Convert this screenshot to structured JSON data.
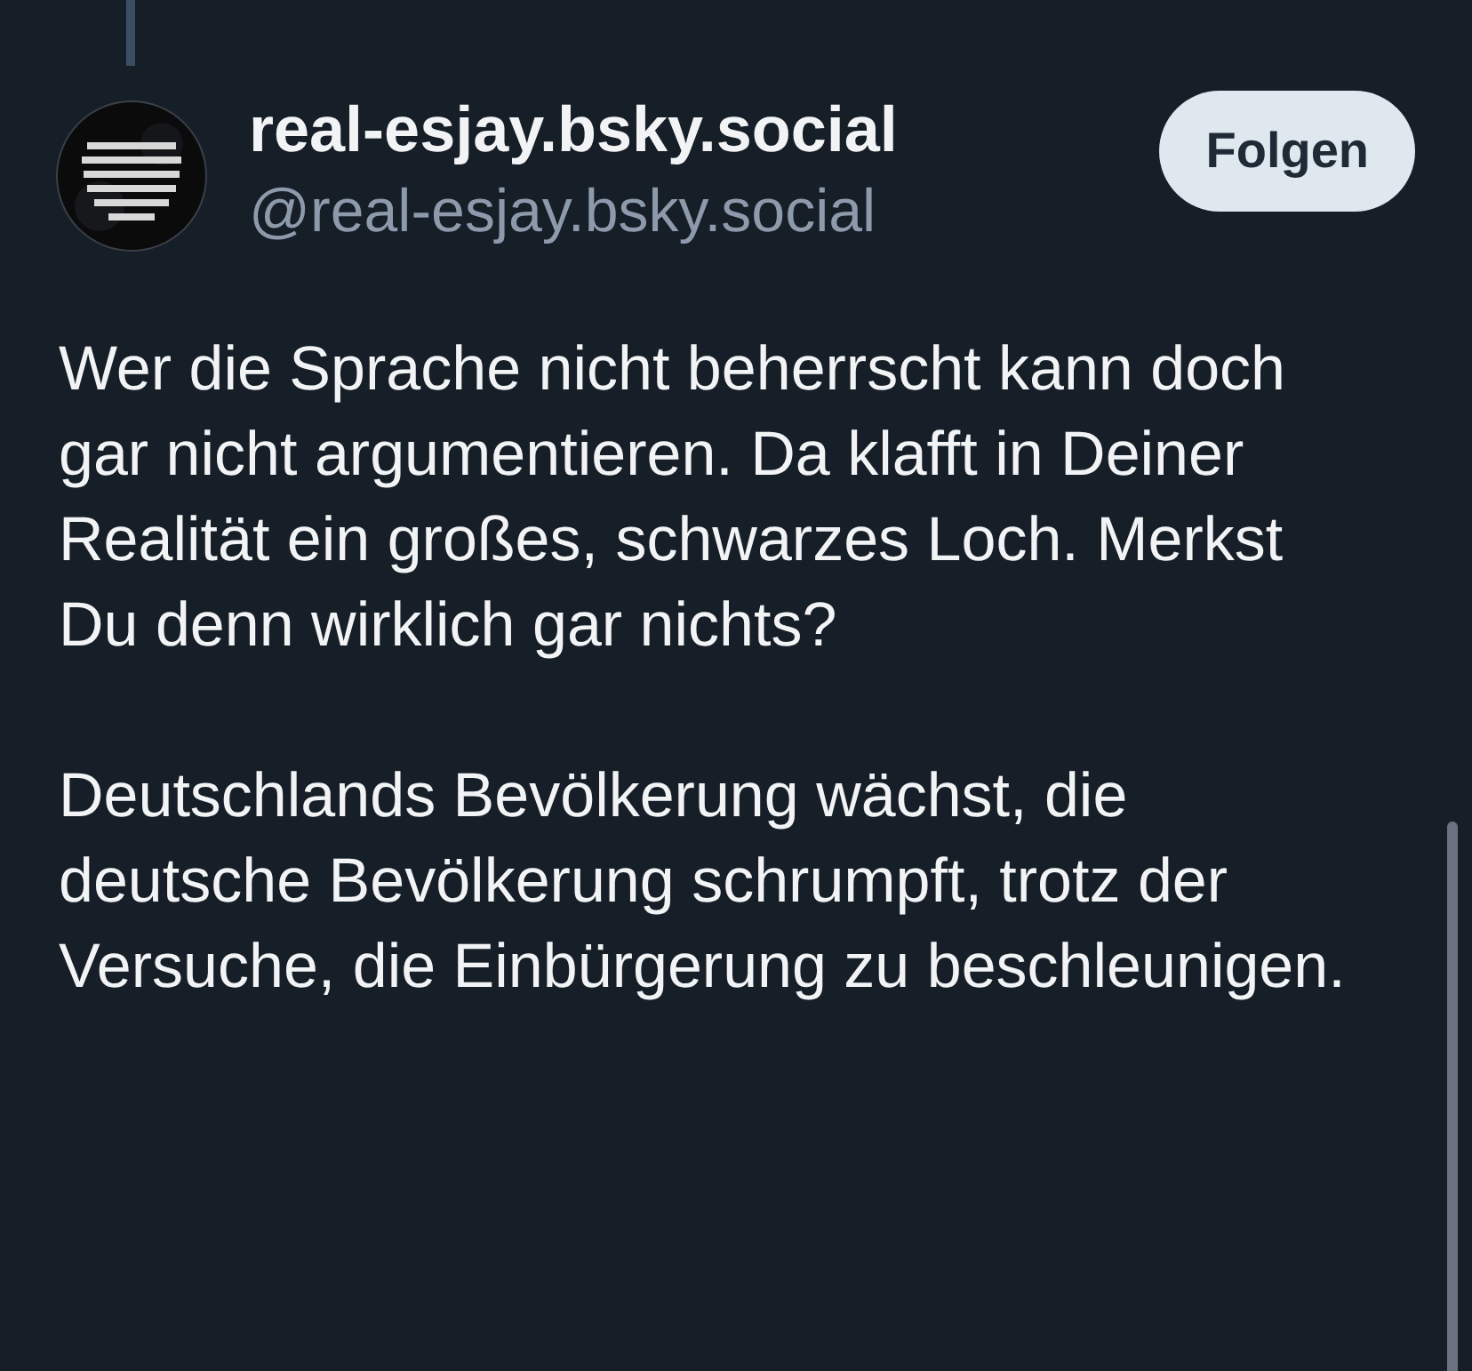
{
  "post": {
    "display_name": "real-esjay.bsky.social",
    "handle": "@real-esjay.bsky.social",
    "follow_button": "Folgen",
    "paragraphs": [
      "Wer die Sprache nicht beherrscht kann doch gar nicht argumentieren. Da klafft in Deiner Realität ein großes, schwarzes Loch. Merkst Du denn wirklich gar nichts?",
      "Deutschlands Bevölkerung wächst, die deutsche Bevölkerung schrumpft, trotz der Versuche, die Einbürgerung zu beschleunigen."
    ]
  }
}
